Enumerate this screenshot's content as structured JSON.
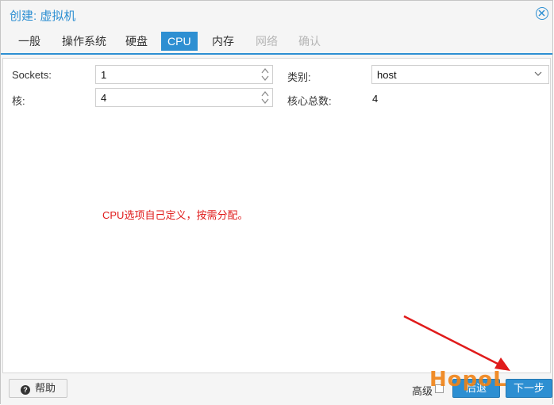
{
  "dialog": {
    "title": "创建: 虚拟机"
  },
  "tabs": [
    {
      "label": "一般",
      "state": "normal"
    },
    {
      "label": "操作系统",
      "state": "normal"
    },
    {
      "label": "硬盘",
      "state": "normal"
    },
    {
      "label": "CPU",
      "state": "active"
    },
    {
      "label": "内存",
      "state": "normal"
    },
    {
      "label": "网络",
      "state": "disabled"
    },
    {
      "label": "确认",
      "state": "disabled"
    }
  ],
  "form": {
    "sockets_label": "Sockets:",
    "sockets_value": "1",
    "cores_label": "核:",
    "cores_value": "4",
    "type_label": "类别:",
    "type_value": "host",
    "total_cores_label": "核心总数:",
    "total_cores_value": "4"
  },
  "annotation": {
    "text": "CPU选项自己定义，按需分配。",
    "color": "#e01b1b"
  },
  "footer": {
    "help_label": "帮助",
    "advanced_label": "高级",
    "back_label": "后退",
    "next_label": "下一步"
  },
  "watermark": {
    "text": "HopoL"
  },
  "colors": {
    "accent": "#2d8fd2",
    "annotation_red": "#e01b1b",
    "watermark_orange": "#f08214"
  }
}
